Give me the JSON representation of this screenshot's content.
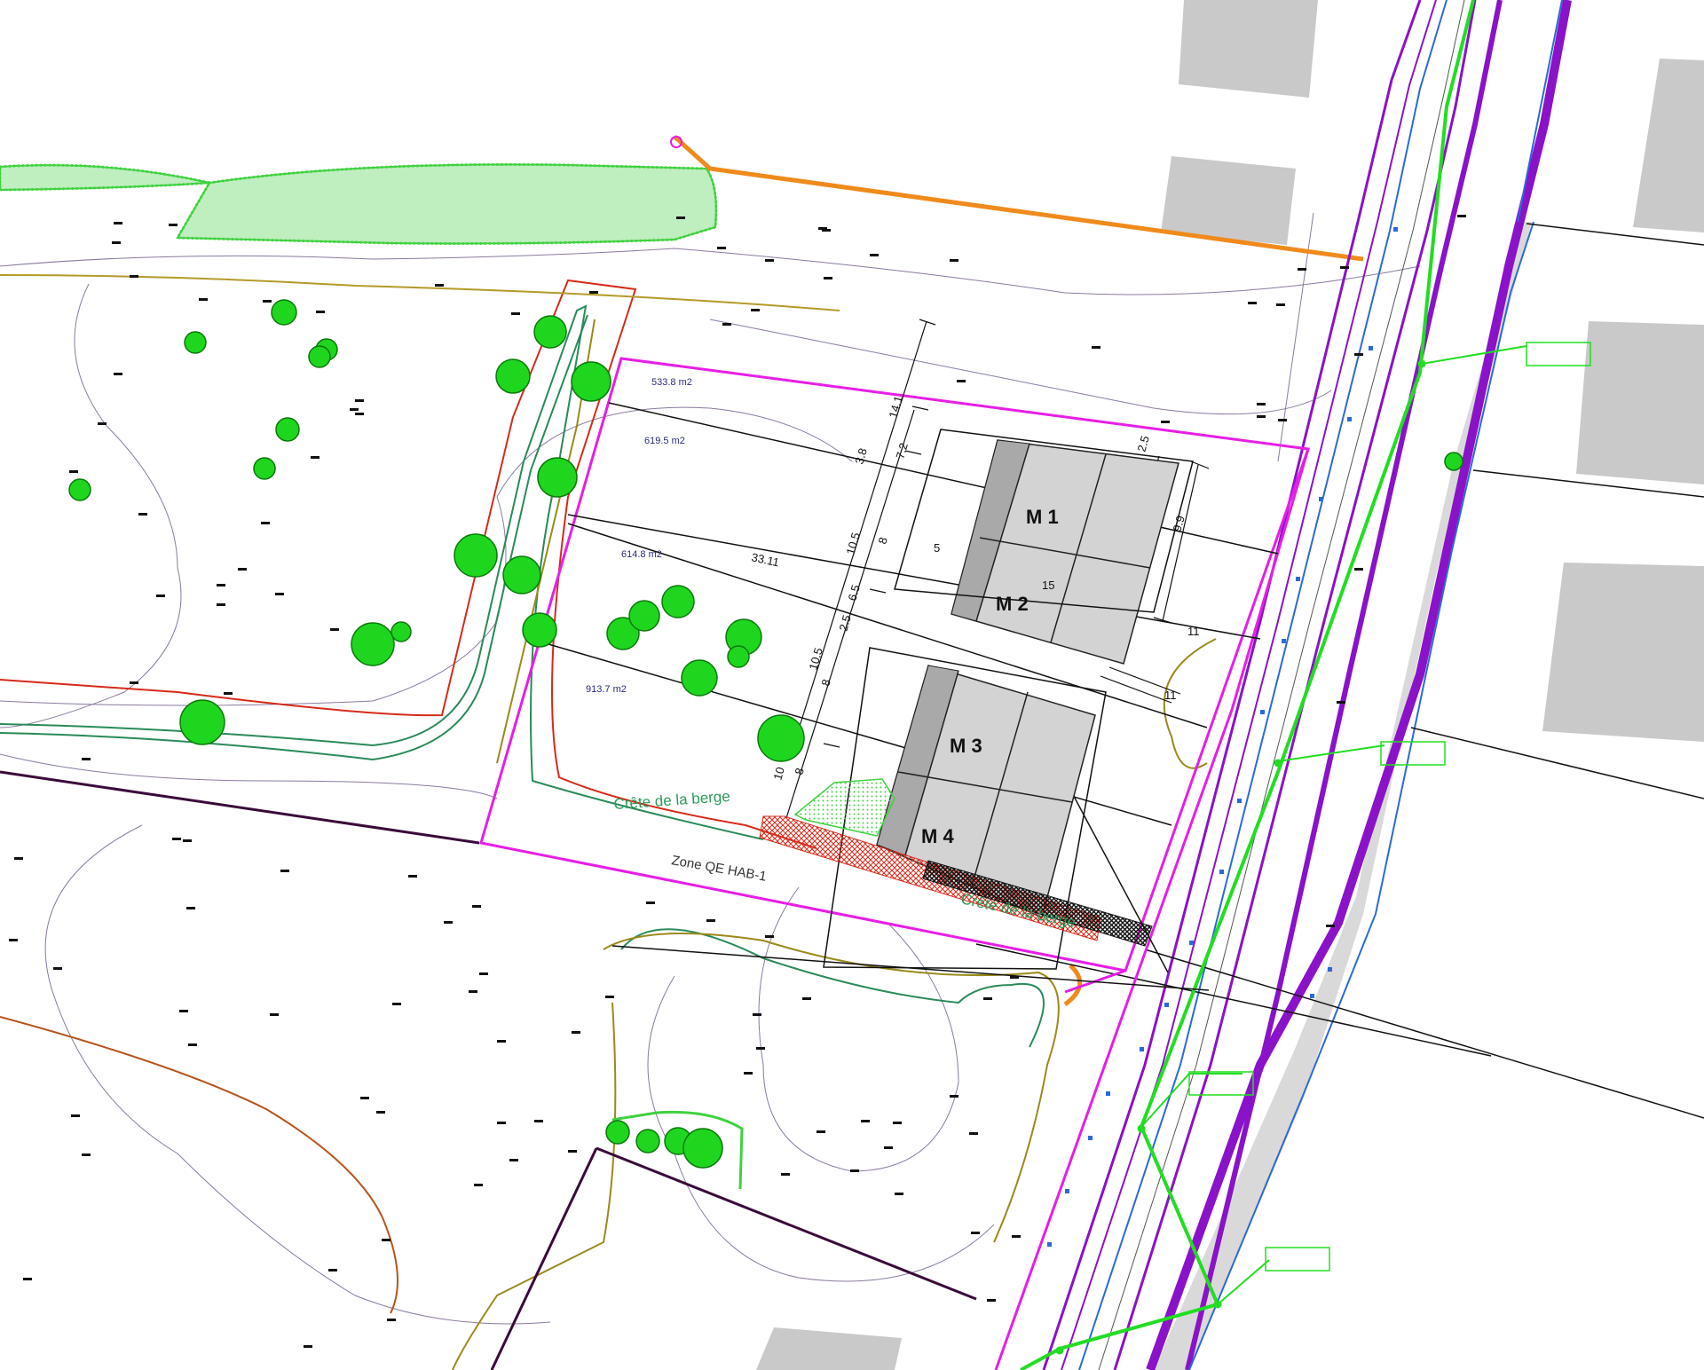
{
  "houses": [
    {
      "id": "m1",
      "label": "M 1"
    },
    {
      "id": "m2",
      "label": "M 2"
    },
    {
      "id": "m3",
      "label": "M 3"
    },
    {
      "id": "m4",
      "label": "M 4"
    }
  ],
  "parcel_areas": [
    {
      "id": "a1",
      "label": "533.8  m2"
    },
    {
      "id": "a2",
      "label": "619.5 m2"
    },
    {
      "id": "a3",
      "label": "614.8 m2"
    },
    {
      "id": "a4",
      "label": "913.7 m2"
    }
  ],
  "dimensions": [
    {
      "id": "d1",
      "label": "14.1"
    },
    {
      "id": "d2",
      "label": "7.2"
    },
    {
      "id": "d3",
      "label": "3.8"
    },
    {
      "id": "d4",
      "label": "10.5"
    },
    {
      "id": "d5",
      "label": "8"
    },
    {
      "id": "d6",
      "label": "6.5"
    },
    {
      "id": "d7",
      "label": "2.5"
    },
    {
      "id": "d8",
      "label": "10.5"
    },
    {
      "id": "d9",
      "label": "8"
    },
    {
      "id": "d10",
      "label": "10"
    },
    {
      "id": "d11",
      "label": "8"
    },
    {
      "id": "d12",
      "label": "2.5"
    },
    {
      "id": "d13",
      "label": "9.9"
    },
    {
      "id": "d14",
      "label": "5"
    },
    {
      "id": "d15",
      "label": "15"
    },
    {
      "id": "d16",
      "label": "33.11"
    },
    {
      "id": "d17",
      "label": "11"
    },
    {
      "id": "d18",
      "label": "11"
    }
  ],
  "annotations": {
    "crete_label_1": "Crête de la berge",
    "crete_label_2": "Crête de la berge",
    "zone_label": "Zone QE HAB-1"
  },
  "colors": {
    "parcel_outline": "#e61ee6",
    "hedge": "#3fd13f",
    "tree": "#1ed61e",
    "water_network": "#22dd22",
    "gas_line": "#f08a1c",
    "road_edge": "#8a12c8",
    "road_blue": "#2a6ad8",
    "contour": "#7a5a8a",
    "buildings": "#c9c9c9",
    "riverbank_red": "#d62a1a",
    "riverbank_green": "#2a8a5a",
    "riverbank_olive": "#9a8a1a"
  }
}
